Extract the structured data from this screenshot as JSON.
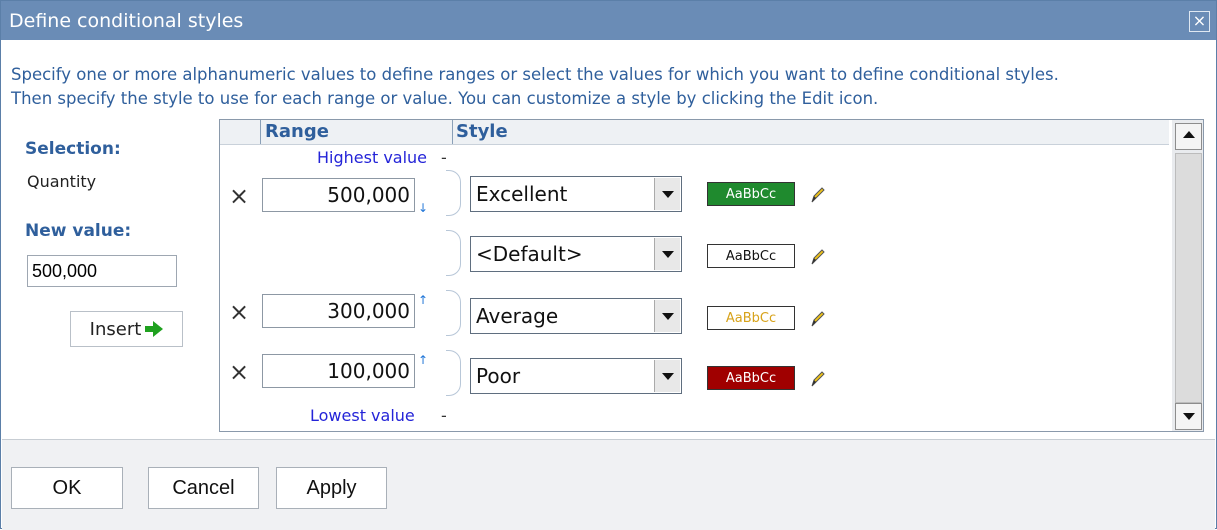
{
  "dialog": {
    "title": "Define conditional styles",
    "close_glyph": "×",
    "instructions": [
      "Specify one or more alphanumeric values to define ranges or select the values for which you want to define conditional styles.",
      "Then specify the style to use for each range or value. You can customize a style by clicking the Edit icon."
    ]
  },
  "left": {
    "selection_label": "Selection:",
    "selection_value": "Quantity",
    "new_value_label": "New value:",
    "new_value": "500,000",
    "insert_label": "Insert",
    "insert_icon": "green-arrow-icon"
  },
  "panel": {
    "headers": {
      "range": "Range",
      "style": "Style"
    },
    "highest_label": "Highest value",
    "lowest_label": "Lowest value",
    "dash": "-",
    "rows": [
      {
        "value": "500,000",
        "arrow": "↓",
        "style": "Excellent",
        "preview": "AaBbCc",
        "preview_bg": "#1f8a2e",
        "preview_color": "#ffffff"
      },
      {
        "value": "",
        "arrow": "",
        "style": "<Default>",
        "preview": "AaBbCc",
        "preview_bg": "#ffffff",
        "preview_color": "#111111"
      },
      {
        "value": "300,000",
        "arrow": "↑",
        "style": "Average",
        "preview": "AaBbCc",
        "preview_bg": "#ffffff",
        "preview_color": "#d7a21a"
      },
      {
        "value": "100,000",
        "arrow": "↑",
        "style": "Poor",
        "preview": "AaBbCc",
        "preview_bg": "#a00000",
        "preview_color": "#ffffff"
      }
    ]
  },
  "buttons": {
    "ok": "OK",
    "cancel": "Cancel",
    "apply": "Apply"
  },
  "colors": {
    "titlebar": "#6a8cb6",
    "instruction_text": "#2f5f9c",
    "blue_labels": "#2424d8"
  }
}
